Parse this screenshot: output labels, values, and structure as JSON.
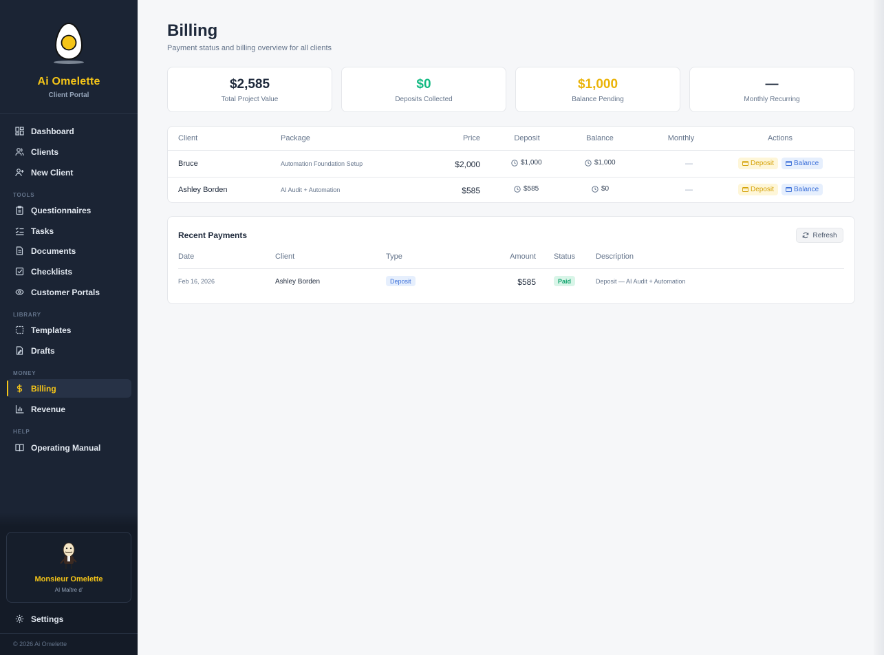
{
  "brand": {
    "title": "Ai Omelette",
    "subtitle": "Client Portal"
  },
  "nav": {
    "main": [
      {
        "label": "Dashboard",
        "icon": "dashboard-icon"
      },
      {
        "label": "Clients",
        "icon": "users-icon"
      },
      {
        "label": "New Client",
        "icon": "user-plus-icon"
      }
    ],
    "tools_label": "TOOLS",
    "tools": [
      {
        "label": "Questionnaires",
        "icon": "clipboard-icon"
      },
      {
        "label": "Tasks",
        "icon": "list-check-icon"
      },
      {
        "label": "Documents",
        "icon": "document-icon"
      },
      {
        "label": "Checklists",
        "icon": "check-square-icon"
      },
      {
        "label": "Customer Portals",
        "icon": "eye-icon"
      }
    ],
    "library_label": "LIBRARY",
    "library": [
      {
        "label": "Templates",
        "icon": "template-icon"
      },
      {
        "label": "Drafts",
        "icon": "draft-icon"
      }
    ],
    "money_label": "MONEY",
    "money": [
      {
        "label": "Billing",
        "icon": "dollar-icon",
        "active": true
      },
      {
        "label": "Revenue",
        "icon": "bar-chart-icon"
      }
    ],
    "help_label": "HELP",
    "help": [
      {
        "label": "Operating Manual",
        "icon": "book-icon"
      }
    ]
  },
  "mascot": {
    "name": "Monsieur Omelette",
    "role": "AI Maître d'"
  },
  "settings_label": "Settings",
  "copyright": "© 2026 Ai Omelette",
  "page": {
    "title": "Billing",
    "subtitle": "Payment status and billing overview for all clients"
  },
  "stats": [
    {
      "value": "$2,585",
      "label": "Total Project Value",
      "color": "#1e293b"
    },
    {
      "value": "$0",
      "label": "Deposits Collected",
      "color": "#10b981"
    },
    {
      "value": "$1,000",
      "label": "Balance Pending",
      "color": "#eab308"
    },
    {
      "value": "—",
      "label": "Monthly Recurring",
      "color": "#1e293b"
    }
  ],
  "billing_table": {
    "headers": {
      "client": "Client",
      "package": "Package",
      "price": "Price",
      "deposit": "Deposit",
      "balance": "Balance",
      "monthly": "Monthly",
      "actions": "Actions"
    },
    "rows": [
      {
        "client": "Bruce",
        "package": "Automation Foundation Setup",
        "price": "$2,000",
        "deposit": "$1,000",
        "balance": "$1,000",
        "monthly": "—",
        "deposit_btn": "Deposit",
        "balance_btn": "Balance"
      },
      {
        "client": "Ashley Borden",
        "package": "AI Audit + Automation",
        "price": "$585",
        "deposit": "$585",
        "balance": "$0",
        "monthly": "—",
        "deposit_btn": "Deposit",
        "balance_btn": "Balance"
      }
    ]
  },
  "payments": {
    "title": "Recent Payments",
    "refresh_label": "Refresh",
    "headers": {
      "date": "Date",
      "client": "Client",
      "type": "Type",
      "amount": "Amount",
      "status": "Status",
      "description": "Description"
    },
    "rows": [
      {
        "date": "Feb 16, 2026",
        "client": "Ashley Borden",
        "type": "Deposit",
        "amount": "$585",
        "status": "Paid",
        "description": "Deposit — AI Audit + Automation"
      }
    ]
  },
  "colors": {
    "accent": "#f5c518",
    "sidebar": "#1b2434",
    "success": "#10b981",
    "warning": "#eab308",
    "info": "#3b6fd8"
  }
}
